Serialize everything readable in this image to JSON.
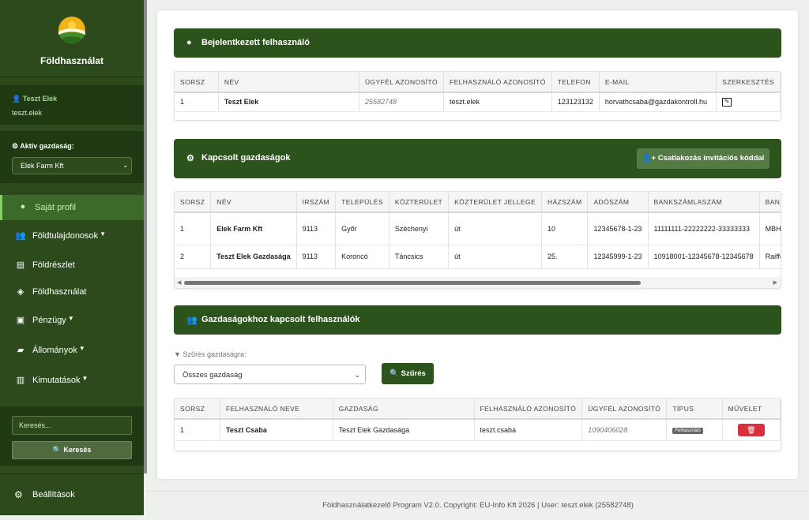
{
  "brand": {
    "title": "Földhasználat"
  },
  "user": {
    "name": "Teszt Elek",
    "login": "teszt.elek"
  },
  "farm_selector": {
    "label": "Aktív gazdaság:",
    "selected": "Elek Farm Kft"
  },
  "nav": [
    {
      "label": "Saját profil",
      "icon": "user-circle-icon",
      "active": true
    },
    {
      "label": "Földtulajdonosok",
      "icon": "users-icon"
    },
    {
      "label": "Földrészlet",
      "icon": "map-icon"
    },
    {
      "label": "Földhasználat",
      "icon": "map-marker-icon"
    },
    {
      "label": "Pénzügy",
      "icon": "money-icon"
    },
    {
      "label": "Állományok",
      "icon": "folder-icon"
    },
    {
      "label": "Kimutatások",
      "icon": "chart-icon"
    }
  ],
  "sidebar_search": {
    "placeholder": "Keresés...",
    "button": "Keresés"
  },
  "settings": {
    "label": "Beállítások"
  },
  "logged_user_section": {
    "title": "Bejelentkezett felhasználó",
    "columns": [
      "SORSZ",
      "NÉV",
      "ÜGYFÉL AZONOSÍTÓ",
      "FELHASZNÁLÓ AZONOSÍTÓ",
      "TELEFON",
      "E-MAIL",
      "SZERKESZTÉS"
    ],
    "row": {
      "sorsz": "1",
      "nev": "Teszt Elek",
      "ugyfel": "25582748",
      "felhasznalo": "teszt.elek",
      "telefon": "123123132",
      "email": "horvathcsaba@gazdakontroll.hu"
    }
  },
  "farms_section": {
    "title": "Kapcsolt gazdaságok",
    "invite_button": "Csatlakozás invitációs kóddal",
    "columns": [
      "SORSZ",
      "NÉV",
      "IRSZÁM",
      "TELEPÜLÉS",
      "KÖZTERÜLET",
      "KÖZTERÜLET JELLEGE",
      "HÁZSZÁM",
      "ADÓSZÁM",
      "BANKSZÁMLASZÁM",
      "BANK NEVE"
    ],
    "rows": [
      [
        "1",
        "Elek Farm Kft",
        "9113",
        "Győr",
        "Széchenyi",
        "út",
        "10",
        "12345678-1-23",
        "11111111-22222222-33333333",
        "MBH Bank"
      ],
      [
        "2",
        "Teszt Elek Gazdasága",
        "9113",
        "Koroncó",
        "Táncsics",
        "út",
        "25.",
        "12345999-1-23",
        "10918001-12345678-12345678",
        "Raiffeisen Bank"
      ]
    ]
  },
  "farm_users_section": {
    "title": "Gazdaságokhoz kapcsolt felhasználók",
    "filter_label": "Szűrés gazdaságra:",
    "filter_selected": "Összes gazdaság",
    "filter_button": "Szűrés",
    "columns": [
      "SORSZ",
      "FELHASZNÁLÓ NEVE",
      "GAZDASÁG",
      "FELHASZNÁLÓ AZONOSÍTÓ",
      "ÜGYFÉL AZONOSÍTÓ",
      "TÍPUS",
      "MŰVELET"
    ],
    "rows": [
      {
        "sorsz": "1",
        "nev": "Teszt Csaba",
        "gazdasag": "Teszt Elek Gazdasága",
        "azonosito": "teszt.csaba",
        "ugyfel": "1090406028",
        "tipus": "Felhasználó"
      }
    ]
  },
  "footer": "Földhasználatkezelő Program V2.0. Copyright: EU-Info Kft 2026 | User: teszt.elek (25582748)",
  "colors": {
    "sidebar": "#2c4a1c",
    "header": "#2d531d",
    "delete": "#d9303f"
  }
}
